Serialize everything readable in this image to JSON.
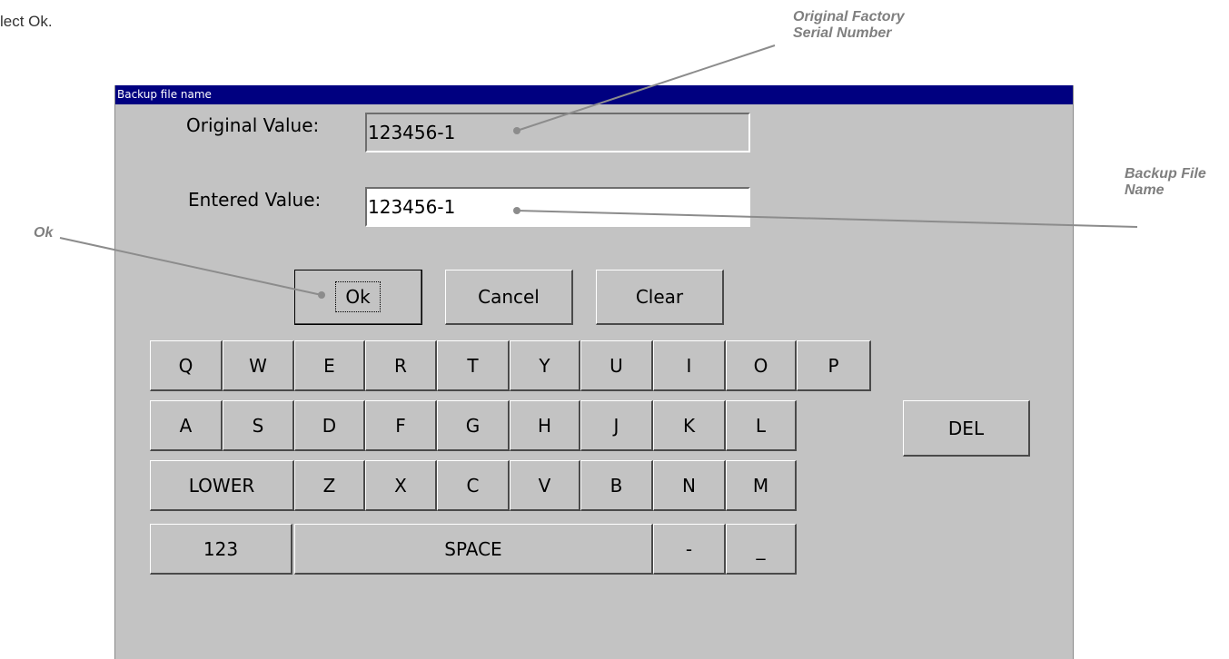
{
  "instruction": "lect Ok.",
  "callouts": {
    "serial": [
      "Original Factory",
      "Serial Number"
    ],
    "backup": [
      "Backup File",
      "Name"
    ],
    "ok": "Ok"
  },
  "dialog": {
    "title": "Backup file name",
    "original_label": "Original Value:",
    "original_value": "123456-1",
    "entered_label": "Entered Value:",
    "entered_value": "123456-1",
    "buttons": {
      "ok": "Ok",
      "cancel": "Cancel",
      "clear": "Clear"
    }
  },
  "keyboard": {
    "row1": [
      "Q",
      "W",
      "E",
      "R",
      "T",
      "Y",
      "U",
      "I",
      "O",
      "P"
    ],
    "row2": [
      "A",
      "S",
      "D",
      "F",
      "G",
      "H",
      "J",
      "K",
      "L"
    ],
    "del": "DEL",
    "lower": "LOWER",
    "row3": [
      "Z",
      "X",
      "C",
      "V",
      "B",
      "N",
      "M"
    ],
    "num": "123",
    "space": "SPACE",
    "dash": "-",
    "underscore": "_"
  },
  "colors": {
    "titlebar": "#000080",
    "window_bg": "#c3c3c3",
    "callout_text": "#7f7f7f",
    "leader_line": "#8c8c8c"
  }
}
